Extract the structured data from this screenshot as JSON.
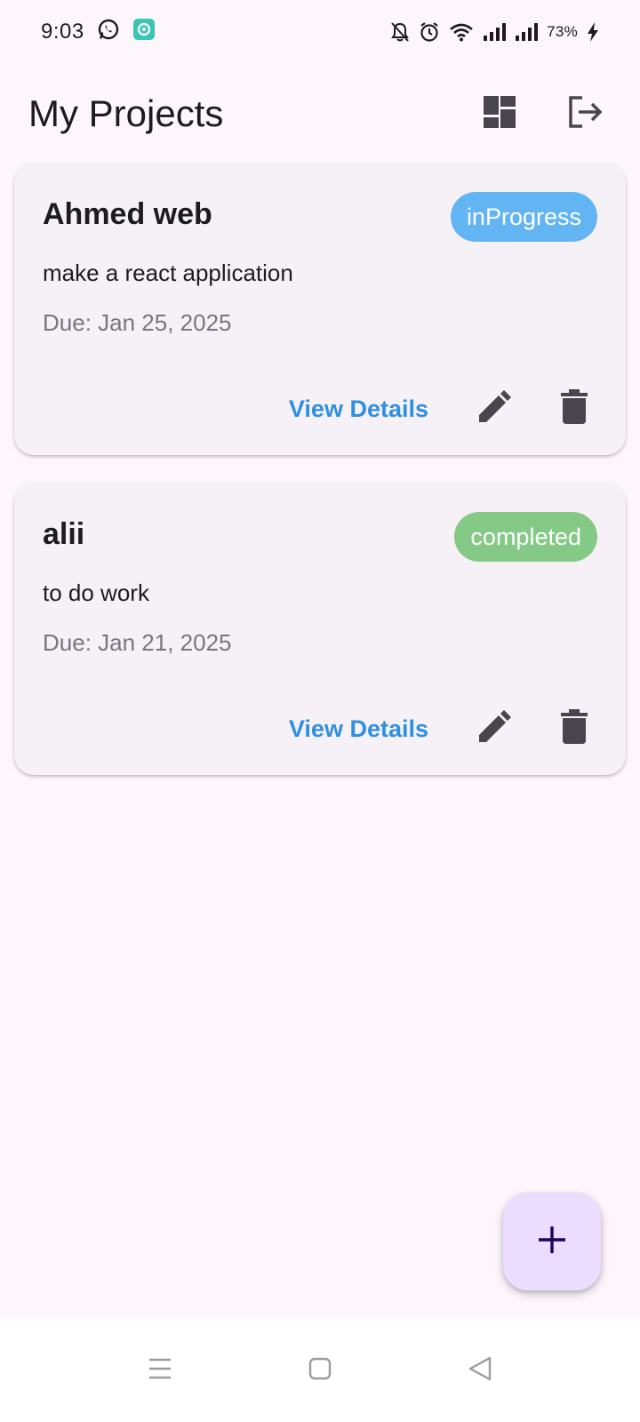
{
  "status_bar": {
    "time": "9:03",
    "battery": "73%",
    "icons": [
      "whatsapp-icon",
      "app-notification-icon",
      "mute-bell-icon",
      "alarm-icon",
      "wifi-icon",
      "signal-icon",
      "signal-icon",
      "charging-icon"
    ]
  },
  "app_bar": {
    "title": "My Projects",
    "actions": [
      "dashboard-icon",
      "logout-icon"
    ]
  },
  "projects": [
    {
      "name": "Ahmed web",
      "status": "inProgress",
      "status_color": "#63b4f3",
      "description": "make a react application",
      "due": "Due: Jan 25, 2025",
      "view_label": "View Details"
    },
    {
      "name": "alii",
      "status": "completed",
      "status_color": "#84c985",
      "description": "to do work",
      "due": "Due: Jan 21, 2025",
      "view_label": "View Details"
    }
  ],
  "fab": {
    "icon": "plus-icon",
    "color": "#eaddff"
  },
  "nav_bar": {
    "icons": [
      "menu-icon",
      "home-square-icon",
      "back-triangle-icon"
    ]
  },
  "colors": {
    "background": "#fdf7fd",
    "card": "#f5f1f7",
    "link": "#2f8fe0",
    "icon": "#49454f"
  }
}
